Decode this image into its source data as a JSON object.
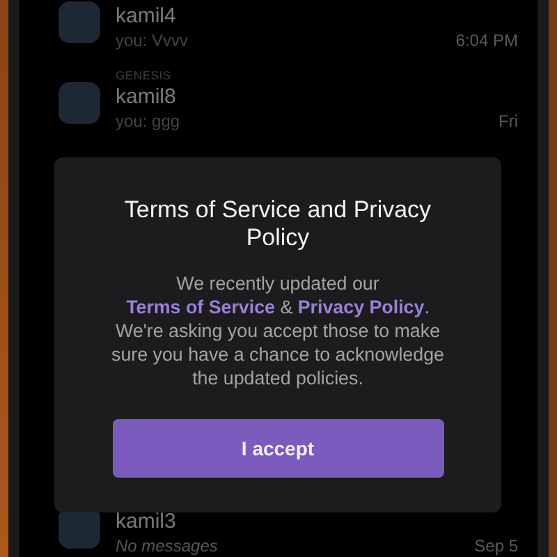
{
  "chats": [
    {
      "kind": "message",
      "name": "kamil4",
      "preview": "you: Vvvv",
      "time": "6:04 PM"
    },
    {
      "kind": "message",
      "group": "GENESIS",
      "name": "kamil8",
      "preview": "you: ggg",
      "time": "Fri"
    },
    {
      "kind": "empty",
      "name": "kamil3",
      "preview": "No messages",
      "time": "Sep 5"
    }
  ],
  "dialog": {
    "title": "Terms of Service and Privacy Policy",
    "body_parts": [
      {
        "text": "We recently updated our ",
        "kind": "plain"
      },
      {
        "text": "Terms of Service",
        "kind": "link"
      },
      {
        "text": " & ",
        "kind": "plain"
      },
      {
        "text": "Privacy Policy",
        "kind": "link"
      },
      {
        "text": ". We're asking you accept those to make sure you have a chance to acknowledge the updated policies.",
        "kind": "plain"
      }
    ],
    "button": "I accept"
  }
}
